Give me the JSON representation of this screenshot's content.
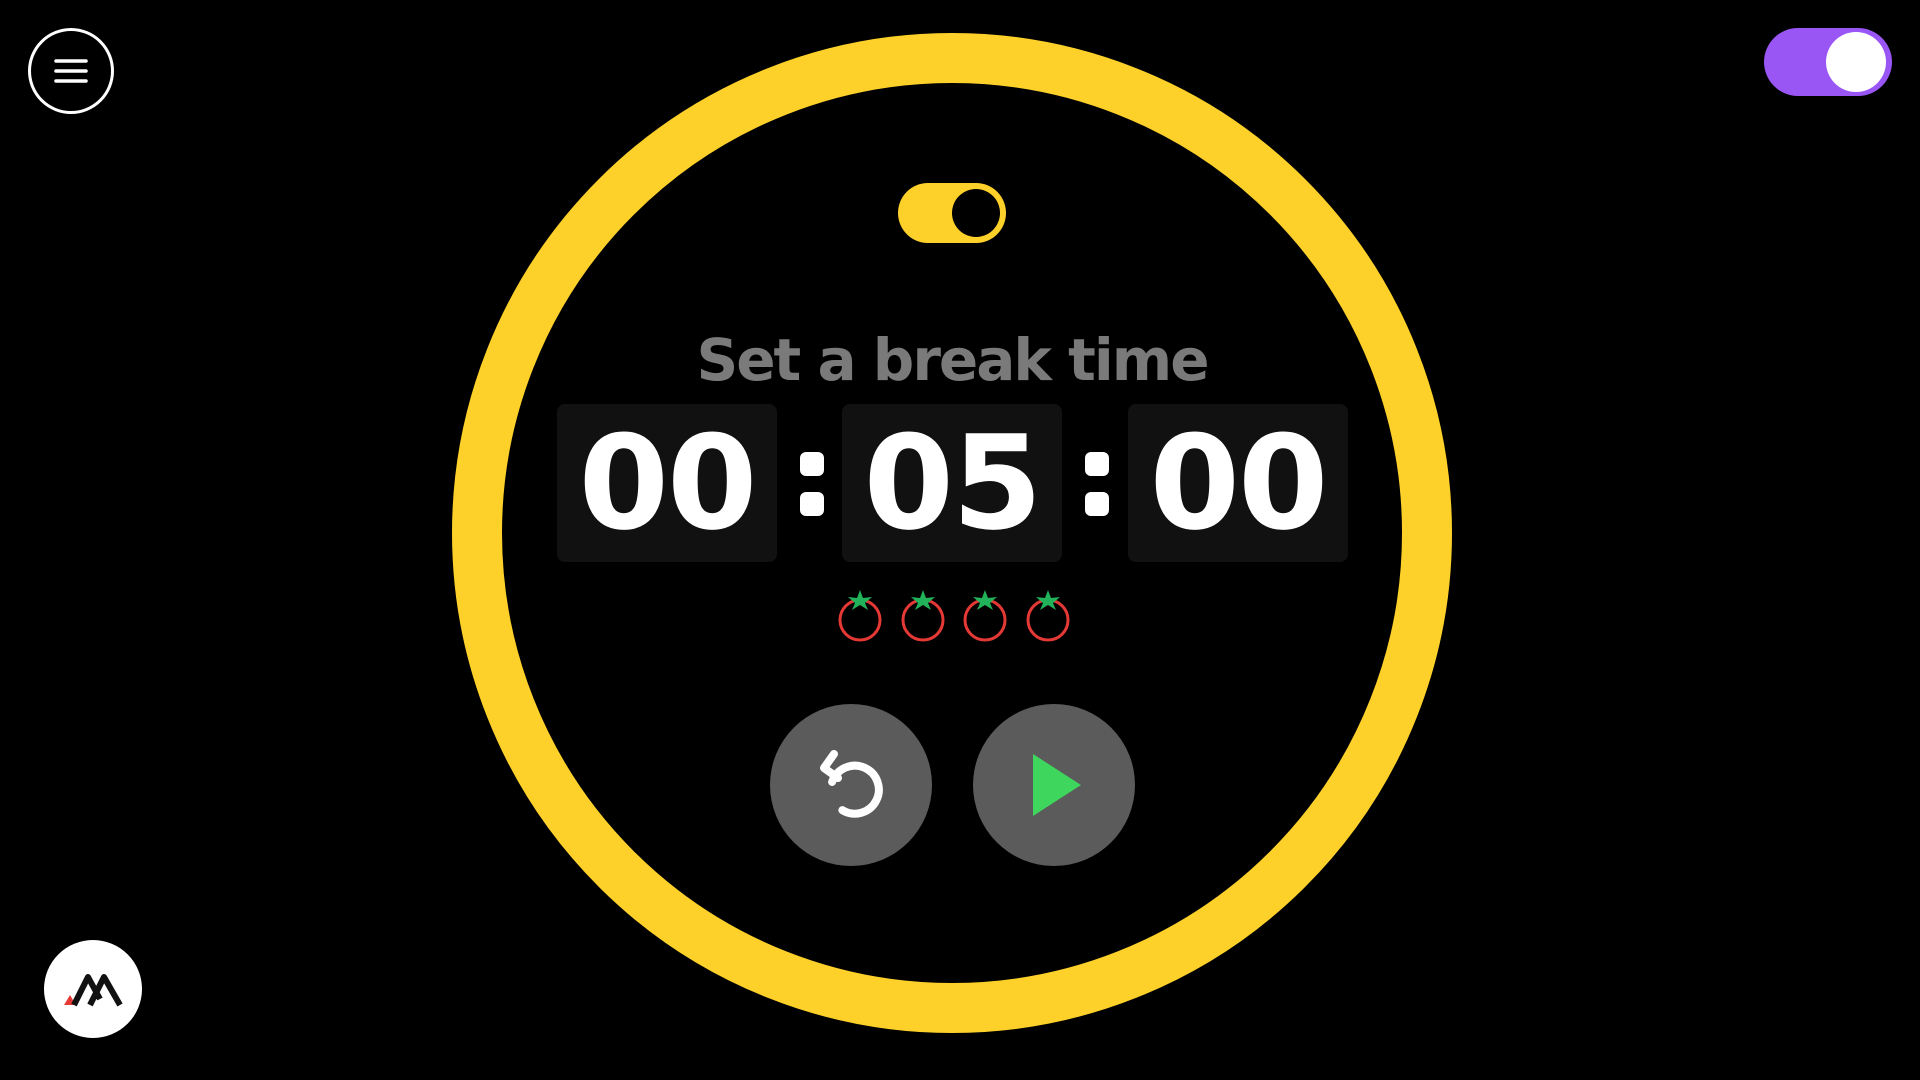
{
  "header": {
    "menu_icon": "hamburger-menu-icon",
    "theme_toggle_on": true
  },
  "timer": {
    "mode_toggle_on": true,
    "title": "Set a break time",
    "hours": "00",
    "minutes": "05",
    "seconds": "00",
    "pomodoro_count": 4
  },
  "controls": {
    "reset_icon": "reset-icon",
    "play_icon": "play-icon"
  },
  "colors": {
    "background": "#000000",
    "ring": "#fdd12a",
    "theme_toggle": "#9a55f5",
    "digit_box": "#111111",
    "title_text": "#7a7a7a",
    "control_button": "#5b5b5b",
    "play": "#3ed65c",
    "tomato_body": "#e53935",
    "tomato_leaf": "#22b35a"
  }
}
